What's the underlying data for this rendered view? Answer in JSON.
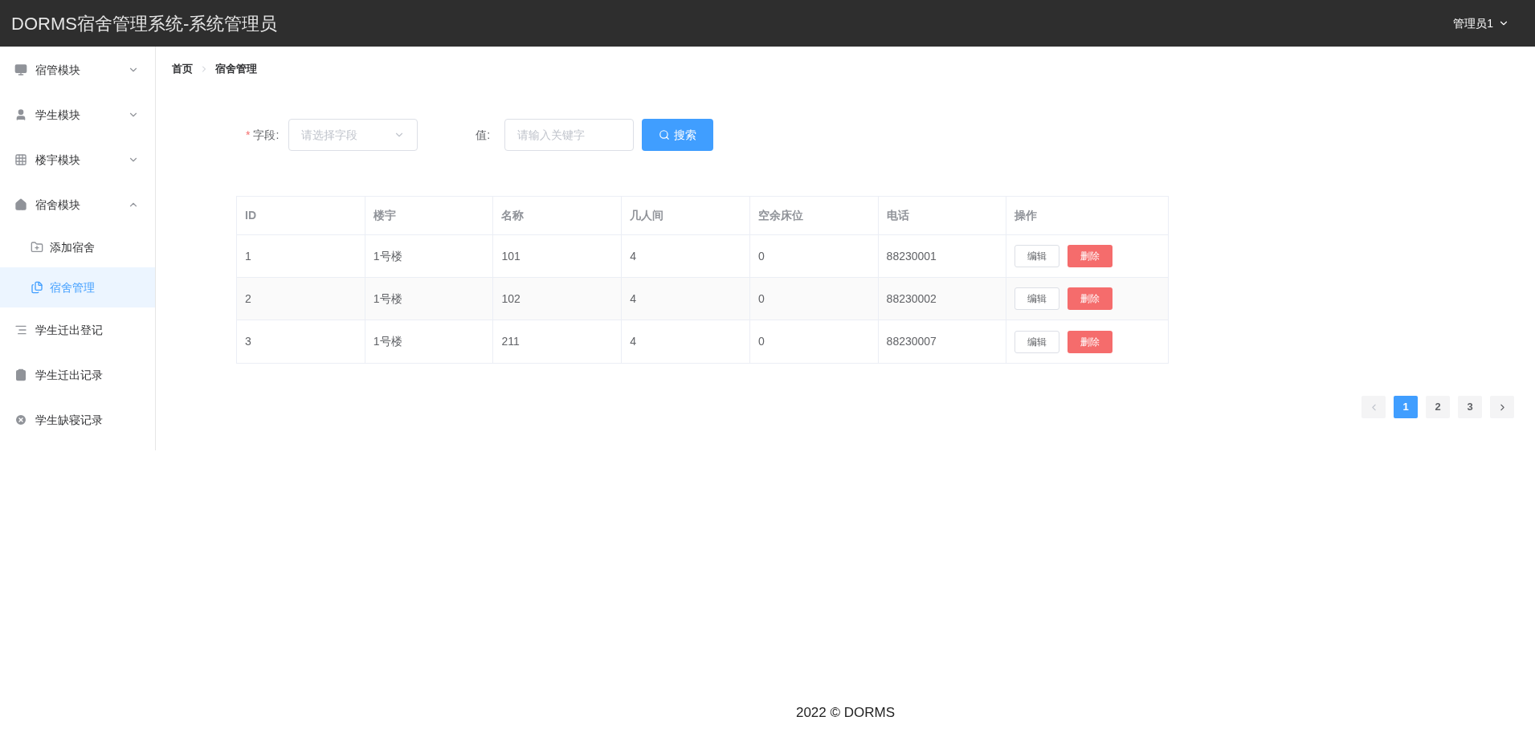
{
  "header": {
    "title": "DORMS宿舍管理系统-系统管理员",
    "user": "管理员1"
  },
  "sidebar": {
    "items": [
      {
        "label": "宿管模块",
        "kind": "group",
        "expanded": false,
        "selected": false
      },
      {
        "label": "学生模块",
        "kind": "group",
        "expanded": false,
        "selected": false
      },
      {
        "label": "楼宇模块",
        "kind": "group",
        "expanded": false,
        "selected": false
      },
      {
        "label": "宿舍模块",
        "kind": "group",
        "expanded": true,
        "selected": false,
        "children": [
          {
            "label": "添加宿舍",
            "selected": false
          },
          {
            "label": "宿舍管理",
            "selected": true
          }
        ]
      },
      {
        "label": "学生迁出登记",
        "kind": "link",
        "selected": false
      },
      {
        "label": "学生迁出记录",
        "kind": "link",
        "selected": false
      },
      {
        "label": "学生缺寝记录",
        "kind": "link",
        "selected": false
      }
    ]
  },
  "breadcrumb": [
    "首页",
    "宿舍管理"
  ],
  "search": {
    "field_label": "字段:",
    "required_mark": "*",
    "field_placeholder": "请选择字段",
    "value_label": "值:",
    "value_placeholder": "请输入关键字",
    "button": "搜索"
  },
  "table": {
    "columns": [
      "ID",
      "楼宇",
      "名称",
      "几人间",
      "空余床位",
      "电话",
      "操作"
    ],
    "rows": [
      {
        "cells": [
          "1",
          "1号楼",
          "101",
          "4",
          "0",
          "88230001"
        ],
        "actions": [
          "编辑",
          "删除"
        ]
      },
      {
        "cells": [
          "2",
          "1号楼",
          "102",
          "4",
          "0",
          "88230002"
        ],
        "actions": [
          "编辑",
          "删除"
        ]
      },
      {
        "cells": [
          "3",
          "1号楼",
          "211",
          "4",
          "0",
          "88230007"
        ],
        "actions": [
          "编辑",
          "删除"
        ]
      }
    ]
  },
  "pagination": {
    "prev_disabled": true,
    "next_disabled": false,
    "pages": [
      {
        "label": "1",
        "selected": true
      },
      {
        "label": "2",
        "selected": false
      },
      {
        "label": "3",
        "selected": false
      }
    ]
  },
  "footer": "2022 © DORMS"
}
